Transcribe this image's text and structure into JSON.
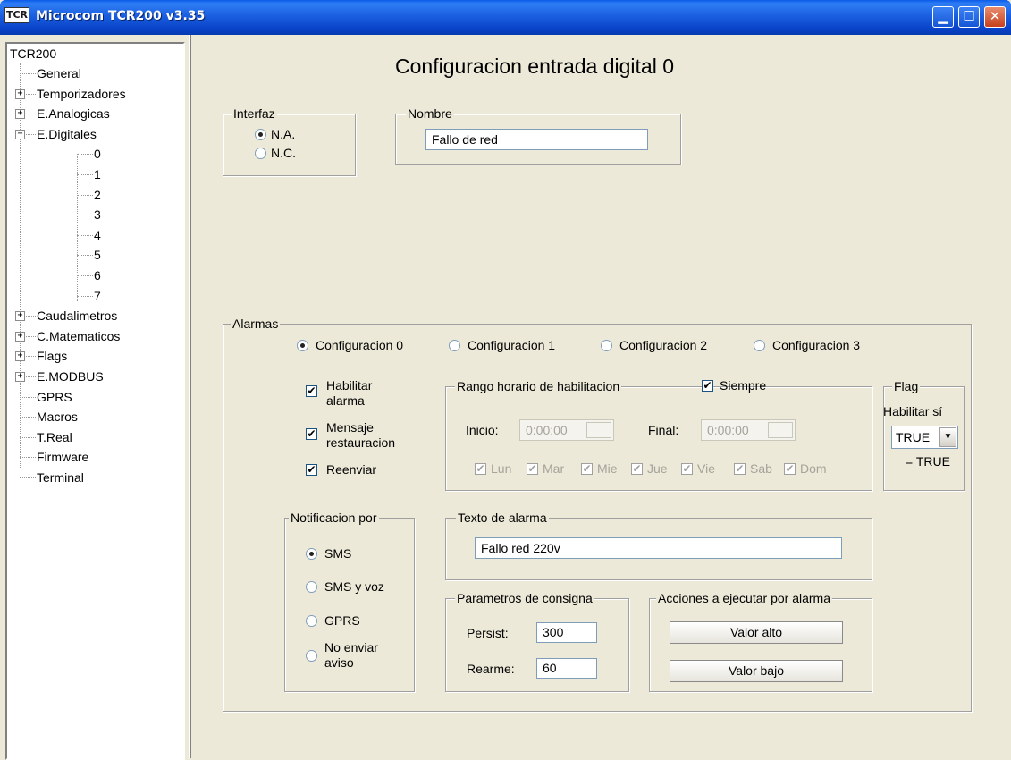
{
  "window": {
    "app_icon": "TCR",
    "title": "Microcom TCR200 v3.35",
    "min_glyph": "▁",
    "max_glyph": "☐",
    "close_glyph": "✕"
  },
  "tree": {
    "root": "TCR200",
    "items": [
      {
        "label": "General"
      },
      {
        "label": "Temporizadores",
        "expander": "+"
      },
      {
        "label": "E.Analogicas",
        "expander": "+"
      },
      {
        "label": "E.Digitales",
        "expander": "−"
      },
      {
        "label": "0"
      },
      {
        "label": "1"
      },
      {
        "label": "2"
      },
      {
        "label": "3"
      },
      {
        "label": "4"
      },
      {
        "label": "5"
      },
      {
        "label": "6"
      },
      {
        "label": "7"
      },
      {
        "label": "Caudalimetros",
        "expander": "+"
      },
      {
        "label": "C.Matematicos",
        "expander": "+"
      },
      {
        "label": "Flags",
        "expander": "+"
      },
      {
        "label": "E.MODBUS",
        "expander": "+"
      },
      {
        "label": "GPRS"
      },
      {
        "label": "Macros"
      },
      {
        "label": "T.Real"
      },
      {
        "label": "Firmware"
      },
      {
        "label": "Terminal"
      }
    ]
  },
  "page": {
    "title": "Configuracion entrada digital  0"
  },
  "interfaz": {
    "legend": "Interfaz",
    "opt_na": "N.A.",
    "opt_nc": "N.C.",
    "selected": "N.A."
  },
  "nombre": {
    "legend": "Nombre",
    "value": "Fallo de red"
  },
  "alarmas": {
    "legend": "Alarmas",
    "configs": [
      "Configuracion 0",
      "Configuracion 1",
      "Configuracion 2",
      "Configuracion 3"
    ],
    "selected_config": "Configuracion 0",
    "habilitar_line1": "Habilitar",
    "habilitar_line2": "alarma",
    "mensaje_line1": "Mensaje",
    "mensaje_line2": "restauracion",
    "reenviar": "Reenviar",
    "check_glyph": "✔",
    "rango": {
      "legend": "Rango horario de habilitacion",
      "siempre": "Siempre",
      "inicio_label": "Inicio:",
      "inicio_value": "0:00:00",
      "final_label": "Final:",
      "final_value": "0:00:00",
      "days": [
        "Lun",
        "Mar",
        "Mie",
        "Jue",
        "Vie",
        "Sab",
        "Dom"
      ]
    },
    "flag": {
      "legend": "Flag",
      "habilitar": "Habilitar sí",
      "value": "TRUE",
      "arrow": "▼",
      "result": "= TRUE"
    },
    "notificacion": {
      "legend": "Notificacion por",
      "sms": "SMS",
      "sms_voz": "SMS y voz",
      "gprs": "GPRS",
      "no_line1": "No enviar",
      "no_line2": "aviso",
      "selected": "SMS"
    },
    "texto": {
      "legend": "Texto de alarma",
      "value": "Fallo red 220v"
    },
    "parametros": {
      "legend": "Parametros de consigna",
      "persist_label": "Persist:",
      "persist_value": "300",
      "rearme_label": "Rearme:",
      "rearme_value": "60"
    },
    "acciones": {
      "legend": "Acciones a ejecutar por alarma",
      "valor_alto": "Valor alto",
      "valor_bajo": "Valor bajo"
    }
  }
}
